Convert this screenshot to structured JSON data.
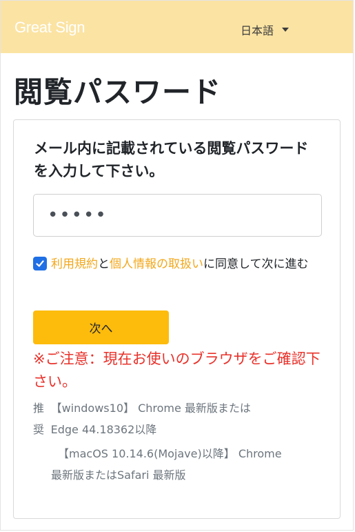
{
  "navbar": {
    "brand": "Great Sign",
    "language": "日本語"
  },
  "page": {
    "title": "閲覧パスワード"
  },
  "form": {
    "heading": "メール内に記載されている閲覧パスワードを入力して下さい。",
    "password_value": "•••••",
    "checkbox_checked": true,
    "terms_link": "利用規約",
    "conjunction": "と",
    "privacy_link": "個人情報の取扱い",
    "agree_suffix": "に同意して次に進む",
    "next_button": "次へ",
    "notice": "※ご注意：現在お使いのブラウザをご確認下さい。",
    "recommend_mark": "推奨",
    "recommend_windows_line1": "【windows10】 Chrome 最新版または",
    "recommend_windows_line2": "Edge 44.18362以降",
    "recommend_mac_line1": "【macOS 10.14.6(Mojave)以降】 Chrome",
    "recommend_mac_line2": "最新版またはSafari 最新版"
  },
  "colors": {
    "navbar_bg": "#fbe3a3",
    "button_bg": "#fdbb0c",
    "link": "#f2a81d",
    "notice": "#e8312a",
    "checkbox": "#1f6fe5"
  }
}
